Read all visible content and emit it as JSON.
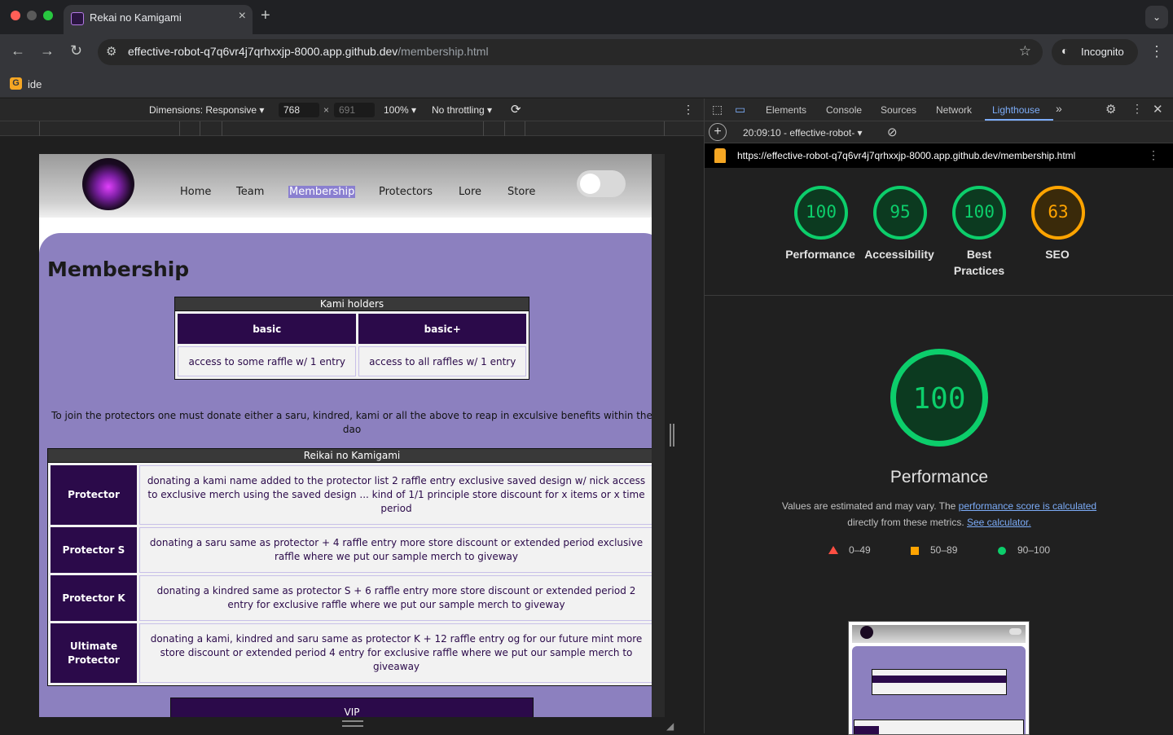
{
  "browser": {
    "tab_title": "Rekai no Kamigami",
    "url_host": "effective-robot-q7q6vr4j7qrhxxjp-8000.app.github.dev",
    "url_path": "/membership.html",
    "incognito_label": "Incognito",
    "bookmark_label": "ide"
  },
  "device_toolbar": {
    "dimensions_label": "Dimensions: Responsive",
    "width": "768",
    "times": "×",
    "height": "691",
    "zoom": "100%",
    "throttling": "No throttling"
  },
  "site": {
    "nav": [
      "Home",
      "Team",
      "Membership",
      "Protectors",
      "Lore",
      "Store"
    ],
    "page_title": "Membership",
    "kami_table": {
      "caption": "Kami holders",
      "headers": [
        "basic",
        "basic+"
      ],
      "cells": [
        "access to some raffle w/ 1 entry",
        "access to all raffles w/ 1 entry"
      ]
    },
    "join_text": "To join the protectors one must donate either a saru, kindred, kami or all the above to reap in exculsive benefits within the dao",
    "reikai_table": {
      "caption": "Reikai no Kamigami",
      "rows": [
        {
          "tier": "Protector",
          "desc": "donating a kami name added to the protector list 2 raffle entry exclusive saved design w/ nick access to exclusive merch using the saved design ... kind of 1/1 principle store discount for x items or x time period"
        },
        {
          "tier": "Protector S",
          "desc": "donating a saru same as protector + 4 raffle entry more store discount or extended period exclusive raffle where we put our sample merch to giveway"
        },
        {
          "tier": "Protector K",
          "desc": "donating a kindred same as protector S + 6 raffle entry more store discount or extended period 2 entry for exclusive raffle where we put our sample merch to giveway"
        },
        {
          "tier": "Ultimate Protector",
          "desc": "donating a kami, kindred and saru same as protector K + 12 raffle entry og for our future mint more store discount or extended period 4 entry for exclusive raffle where we put our sample merch to giveaway"
        }
      ]
    },
    "vip_caption": "VIP"
  },
  "devtools": {
    "tabs": [
      "Elements",
      "Console",
      "Sources",
      "Network",
      "Lighthouse"
    ],
    "active_tab": "Lighthouse",
    "report_select": "20:09:10 - effective-robot-",
    "report_url": "https://effective-robot-q7q6vr4j7qrhxxjp-8000.app.github.dev/membership.html",
    "scores": [
      {
        "label": "Performance",
        "value": "100"
      },
      {
        "label": "Accessibility",
        "value": "95"
      },
      {
        "label": "Best Practices",
        "value": "100"
      },
      {
        "label": "SEO",
        "value": "63"
      }
    ],
    "big_score": "100",
    "big_title": "Performance",
    "note_prefix": "Values are estimated and may vary. The ",
    "note_link1": "performance score is calculated",
    "note_mid": "directly from these metrics. ",
    "note_link2": "See calculator.",
    "legend": [
      "0–49",
      "50–89",
      "90–100"
    ],
    "colors": {
      "pass": "#0cce6b",
      "average": "#ffa400",
      "fail": "#ff4e42",
      "accent": "#7cacf8"
    }
  }
}
